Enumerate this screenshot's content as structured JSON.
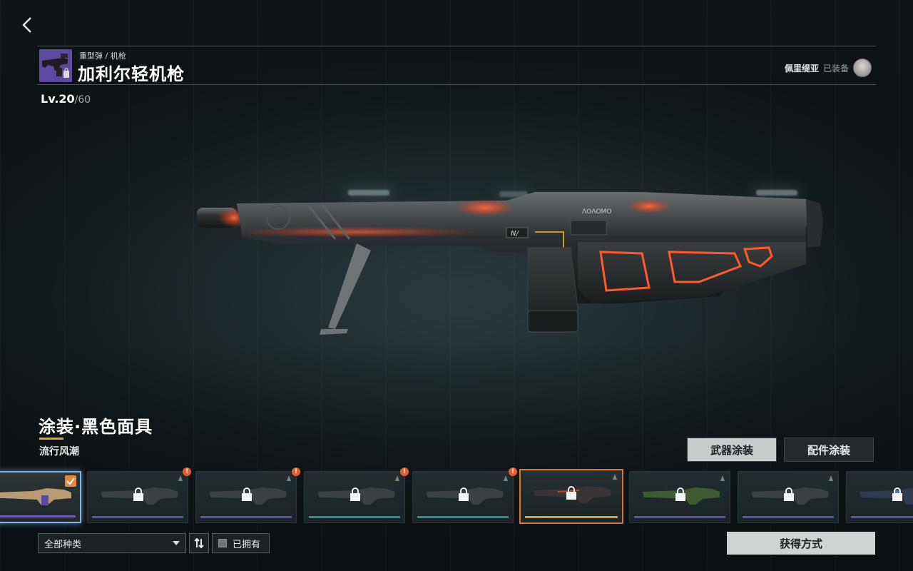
{
  "header": {
    "category": "重型弹 / 机枪",
    "weapon_name": "加利尔轻机枪",
    "equipped_character": "佩里缇亚",
    "equipped_status": "已装备",
    "level": "Lv.20",
    "level_max": "/60"
  },
  "skin": {
    "title": "涂装·黑色面具",
    "series": "流行风潮"
  },
  "tabs": {
    "weapon_skin": "武器涂装",
    "attachment_skin": "配件涂装"
  },
  "skins": [
    {
      "state": "selected-owned",
      "rarity_color": "#6a5bb0",
      "notification": false
    },
    {
      "state": "locked",
      "rarity_color": "#5a4f98",
      "notification": true
    },
    {
      "state": "locked",
      "rarity_color": "#5a4f98",
      "notification": true
    },
    {
      "state": "locked",
      "rarity_color": "#2a8f8f",
      "notification": true
    },
    {
      "state": "locked",
      "rarity_color": "#2a8f8f",
      "notification": true
    },
    {
      "state": "locked-current",
      "rarity_color": "#d0a230",
      "notification": false
    },
    {
      "state": "locked",
      "rarity_color": "#5a4f98",
      "notification": false
    },
    {
      "state": "locked",
      "rarity_color": "#5a4f98",
      "notification": false
    },
    {
      "state": "locked",
      "rarity_color": "#5a4f98",
      "notification": false
    }
  ],
  "notification_mark": "!",
  "filter": {
    "type_select": "全部种类",
    "owned_label": "已拥有",
    "sort_icon": "sort-swap-icon"
  },
  "acquire_button": "获得方式",
  "colors": {
    "accent_orange": "#e28a3a",
    "selected_blue": "#7fb5e8",
    "underline_gold": "#e3a51f",
    "glow_red": "#ff4a2a"
  }
}
